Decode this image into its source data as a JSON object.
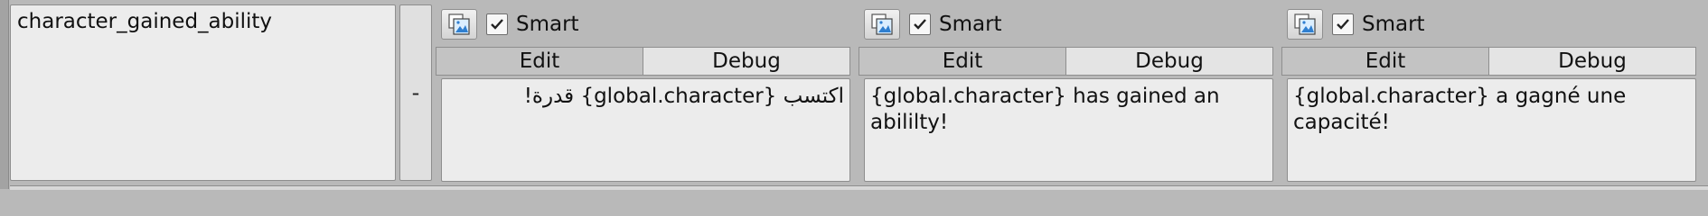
{
  "row": {
    "key": "character_gained_ability",
    "dash": "-"
  },
  "columns": [
    {
      "smart_label": "Smart",
      "smart_checked": true,
      "tabs": {
        "edit": "Edit",
        "debug": "Debug",
        "active": "edit"
      },
      "text": "اكتسب {global.character} قدرة!"
    },
    {
      "smart_label": "Smart",
      "smart_checked": true,
      "tabs": {
        "edit": "Edit",
        "debug": "Debug",
        "active": "edit"
      },
      "text": "{global.character} has gained an abililty!"
    },
    {
      "smart_label": "Smart",
      "smart_checked": true,
      "tabs": {
        "edit": "Edit",
        "debug": "Debug",
        "active": "edit"
      },
      "text": "{global.character} a gagné une capacité!"
    }
  ],
  "icons": {
    "image_button": "image-preview-icon",
    "checkbox": "checkmark-icon"
  },
  "colors": {
    "background": "#b9b9b9",
    "field": "#ececec",
    "active_tab": "#c3c3c3",
    "inactive_tab": "#e4e4e4",
    "icon_blue": "#2f7fd0"
  }
}
